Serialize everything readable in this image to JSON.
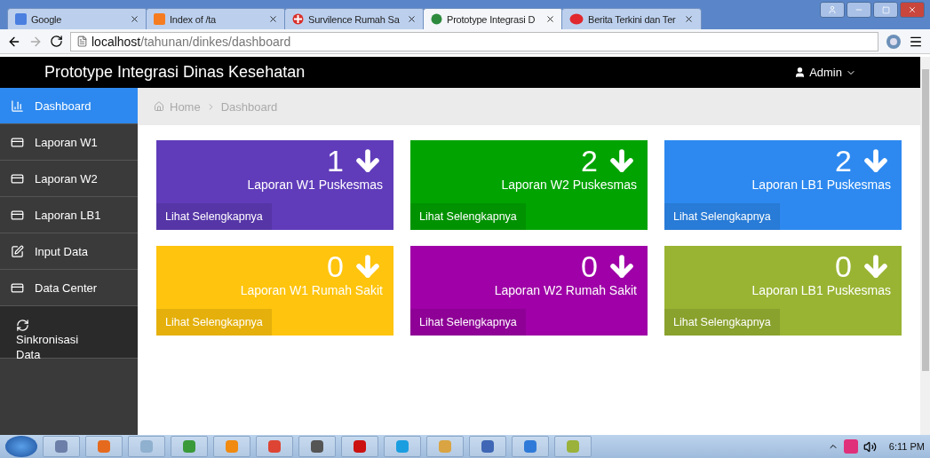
{
  "browser": {
    "tabs": [
      {
        "title": "Google",
        "kind": "google",
        "selected": false
      },
      {
        "title": "Index of /ta",
        "kind": "xampp",
        "selected": false
      },
      {
        "title": "Survilence Rumah Sa",
        "kind": "cross",
        "selected": false
      },
      {
        "title": "Prototype Integrasi D",
        "kind": "leaf",
        "selected": true
      },
      {
        "title": "Berita Terkini dan Ter",
        "kind": "news",
        "selected": false
      }
    ],
    "url_host": "localhost",
    "url_path": "/tahunan/dinkes/dashboard"
  },
  "navbar": {
    "brand": "Prototype Integrasi Dinas Kesehatan",
    "user": "Admin"
  },
  "sidebar": {
    "items": [
      {
        "label": "Dashboard",
        "kind": "chart",
        "selected": true
      },
      {
        "label": "Laporan W1",
        "kind": "card",
        "selected": false
      },
      {
        "label": "Laporan W2",
        "kind": "card",
        "selected": false
      },
      {
        "label": "Laporan LB1",
        "kind": "card",
        "selected": false
      },
      {
        "label": "Input Data",
        "kind": "edit",
        "selected": false
      },
      {
        "label": "Data Center",
        "kind": "card",
        "selected": false
      },
      {
        "label": "Sinkronisasi Data",
        "kind": "sync",
        "selected": false
      }
    ]
  },
  "breadcrumb": [
    "Home",
    "Dashboard"
  ],
  "cards": [
    {
      "count": "1",
      "label": "Laporan W1 Puskesmas",
      "link": "Lihat Selengkapnya",
      "color": "#603cba"
    },
    {
      "count": "2",
      "label": "Laporan W2 Puskesmas",
      "link": "Lihat Selengkapnya",
      "color": "#00a300"
    },
    {
      "count": "2",
      "label": "Laporan LB1 Puskesmas",
      "link": "Lihat Selengkapnya",
      "color": "#2d89ef"
    },
    {
      "count": "0",
      "label": "Laporan W1 Rumah Sakit",
      "link": "Lihat Selengkapnya",
      "color": "#ffc40d"
    },
    {
      "count": "0",
      "label": "Laporan W2 Rumah Sakit",
      "link": "Lihat Selengkapnya",
      "color": "#9f00a7"
    },
    {
      "count": "0",
      "label": "Laporan LB1 Puskesmas",
      "link": "Lihat Selengkapnya",
      "color": "#99b433"
    }
  ],
  "taskbar": {
    "clock": "6:11 PM"
  }
}
